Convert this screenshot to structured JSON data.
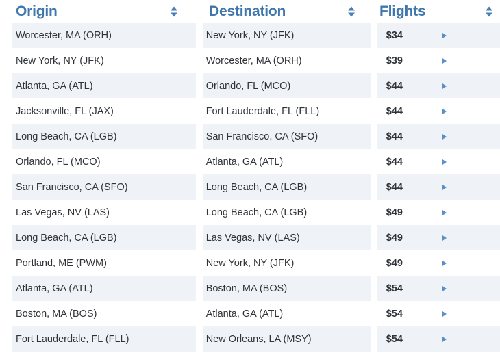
{
  "table": {
    "columns": [
      {
        "key": "origin",
        "label": "Origin",
        "sort_icon": "sort-updown-icon"
      },
      {
        "key": "destination",
        "label": "Destination",
        "sort_icon": "sort-updown-icon"
      },
      {
        "key": "flights",
        "label": "Flights",
        "sort_icon": "sort-updown-icon"
      }
    ],
    "row_action_icon": "caret-right-icon",
    "colors": {
      "header_text": "#3f77ad",
      "row_shaded_bg": "#eff2f6",
      "row_plain_bg": "#ffffff",
      "body_text": "#303338",
      "accent_arrow": "#5b8fc9"
    },
    "rows": [
      {
        "origin": "Worcester, MA (ORH)",
        "destination": "New York, NY (JFK)",
        "flights": "$34"
      },
      {
        "origin": "New York, NY (JFK)",
        "destination": "Worcester, MA (ORH)",
        "flights": "$39"
      },
      {
        "origin": "Atlanta, GA (ATL)",
        "destination": "Orlando, FL (MCO)",
        "flights": "$44"
      },
      {
        "origin": "Jacksonville, FL (JAX)",
        "destination": "Fort Lauderdale, FL (FLL)",
        "flights": "$44"
      },
      {
        "origin": "Long Beach, CA (LGB)",
        "destination": "San Francisco, CA (SFO)",
        "flights": "$44"
      },
      {
        "origin": "Orlando, FL (MCO)",
        "destination": "Atlanta, GA (ATL)",
        "flights": "$44"
      },
      {
        "origin": "San Francisco, CA (SFO)",
        "destination": "Long Beach, CA (LGB)",
        "flights": "$44"
      },
      {
        "origin": "Las Vegas, NV (LAS)",
        "destination": "Long Beach, CA (LGB)",
        "flights": "$49"
      },
      {
        "origin": "Long Beach, CA (LGB)",
        "destination": "Las Vegas, NV (LAS)",
        "flights": "$49"
      },
      {
        "origin": "Portland, ME (PWM)",
        "destination": "New York, NY (JFK)",
        "flights": "$49"
      },
      {
        "origin": "Atlanta, GA (ATL)",
        "destination": "Boston, MA (BOS)",
        "flights": "$54"
      },
      {
        "origin": "Boston, MA (BOS)",
        "destination": "Atlanta, GA (ATL)",
        "flights": "$54"
      },
      {
        "origin": "Fort Lauderdale, FL (FLL)",
        "destination": "New Orleans, LA (MSY)",
        "flights": "$54"
      }
    ]
  }
}
